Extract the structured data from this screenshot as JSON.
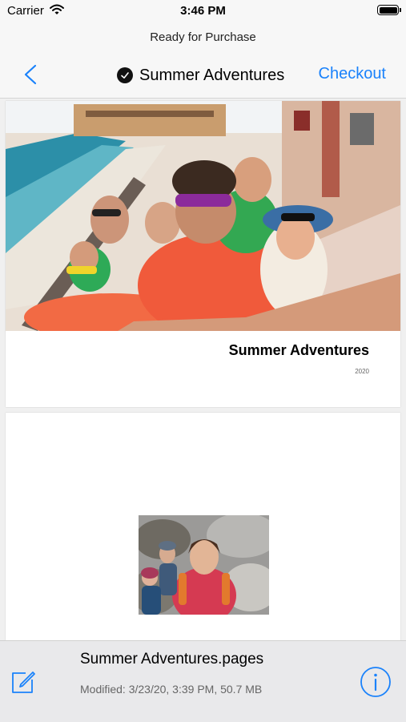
{
  "status_bar": {
    "carrier": "Carrier",
    "time": "3:46 PM"
  },
  "nav": {
    "prompt": "Ready for Purchase",
    "title": "Summer Adventures",
    "checkout_label": "Checkout"
  },
  "pages": [
    {
      "title": "Summer Adventures",
      "year": "2020"
    },
    {}
  ],
  "file": {
    "name": "Summer Adventures.pages",
    "modified": "Modified: 3/23/20, 3:39 PM, 50.7 MB"
  },
  "colors": {
    "accent": "#1a82fb",
    "bar_bg": "#f7f7f7",
    "bottom_bg": "#e9e9eb"
  },
  "icons": [
    "wifi-icon",
    "battery-icon",
    "back-chevron-icon",
    "checkmark-icon",
    "edit-icon",
    "info-icon"
  ]
}
